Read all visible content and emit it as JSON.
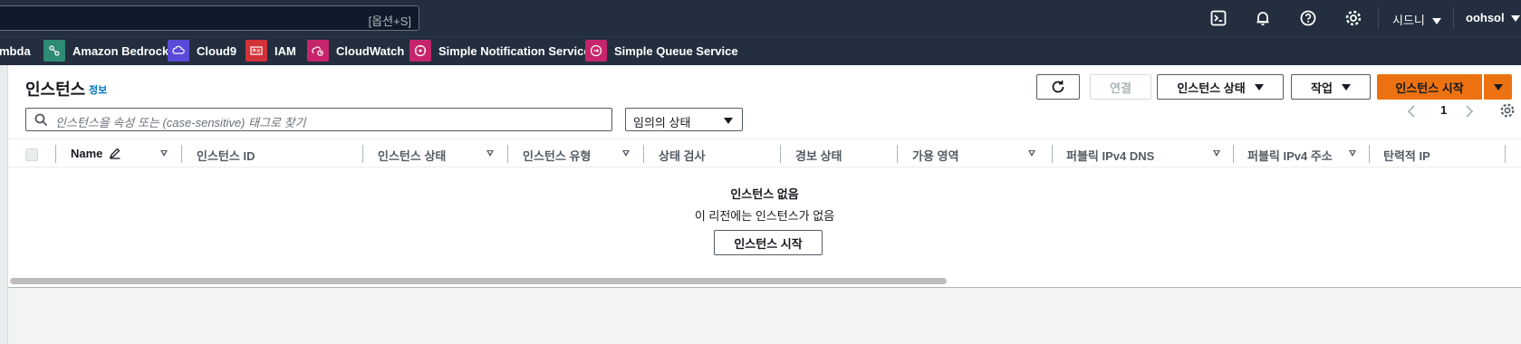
{
  "topnav": {
    "search_shortcut": "[옵션+S]",
    "region_label": "시드니",
    "user_label": "oohsol",
    "icons": [
      "cloudshell-icon",
      "notifications-icon",
      "help-icon",
      "settings-icon"
    ]
  },
  "favorites": [
    {
      "label": "mbda",
      "icon": "lambda-icon",
      "color": "#ed7100"
    },
    {
      "label": "Amazon Bedrock",
      "icon": "bedrock-icon",
      "color": "#2e8b74"
    },
    {
      "label": "Cloud9",
      "icon": "cloud9-icon",
      "color": "#5a4ad9"
    },
    {
      "label": "IAM",
      "icon": "iam-icon",
      "color": "#d13239"
    },
    {
      "label": "CloudWatch",
      "icon": "cloudwatch-icon",
      "color": "#c7256b"
    },
    {
      "label": "Simple Notification Service",
      "icon": "sns-icon",
      "color": "#c7256b"
    },
    {
      "label": "Simple Queue Service",
      "icon": "sqs-icon",
      "color": "#c7256b"
    }
  ],
  "panel": {
    "title": "인스턴스",
    "info_label": "정보",
    "buttons": {
      "refresh": "refresh-icon",
      "connect": "연결",
      "instance_state": "인스턴스 상태",
      "actions": "작업",
      "launch": "인스턴스 시작"
    },
    "filter_placeholder": "인스턴스을 속성 또는 (case-sensitive) 태그로 찾기",
    "state_select": "임의의 상태",
    "page_number": "1"
  },
  "table": {
    "columns": [
      "Name",
      "인스턴스 ID",
      "인스턴스 상태",
      "인스턴스 유형",
      "상태 검사",
      "경보 상태",
      "가용 영역",
      "퍼블릭 IPv4 DNS",
      "퍼블릭 IPv4 주소",
      "탄력적 IP"
    ],
    "empty_title": "인스턴스 없음",
    "empty_subtitle": "이 리전에는 인스턴스가 없음",
    "empty_button": "인스턴스 시작"
  },
  "colors": {
    "nav_bg": "#232f3e",
    "primary": "#ec7211",
    "link": "#0073bb"
  }
}
